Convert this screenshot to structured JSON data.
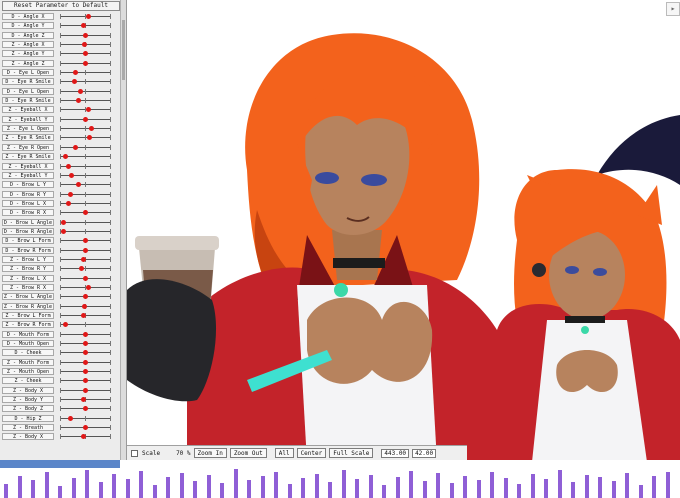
{
  "panel": {
    "reset_label": "Reset Parameter to Default",
    "params": [
      {
        "label": "D - Angle X",
        "value": 0.55
      },
      {
        "label": "D - Angle Y",
        "value": 0.45
      },
      {
        "label": "D - Angle Z",
        "value": 0.5
      },
      {
        "label": "Z - Angle X",
        "value": 0.48
      },
      {
        "label": "Z - Angle Y",
        "value": 0.5
      },
      {
        "label": "Z - Angle Z",
        "value": 0.5
      },
      {
        "label": "D - Eye L Open",
        "value": 0.3
      },
      {
        "label": "D - Eye R Smile",
        "value": 0.28
      },
      {
        "label": "D - Eye L Open",
        "value": 0.4
      },
      {
        "label": "D - Eye R Smile",
        "value": 0.35
      },
      {
        "label": "Z - Eyeball X",
        "value": 0.55
      },
      {
        "label": "Z - Eyeball Y",
        "value": 0.5
      },
      {
        "label": "Z - Eye L Open",
        "value": 0.62
      },
      {
        "label": "Z - Eye R Smile",
        "value": 0.58
      },
      {
        "label": "Z - Eye R Open",
        "value": 0.3
      },
      {
        "label": "Z - Eye R Smile",
        "value": 0.1
      },
      {
        "label": "Z - Eyeball X",
        "value": 0.15
      },
      {
        "label": "Z - Eyeball Y",
        "value": 0.22
      },
      {
        "label": "D - Brow L Y",
        "value": 0.35
      },
      {
        "label": "D - Brow R Y",
        "value": 0.2
      },
      {
        "label": "D - Brow L X",
        "value": 0.15
      },
      {
        "label": "D - Brow R X",
        "value": 0.5
      },
      {
        "label": "D - Brow L Angle",
        "value": 0.05
      },
      {
        "label": "D - Brow R Angle",
        "value": 0.05
      },
      {
        "label": "D - Brow L Form",
        "value": 0.5
      },
      {
        "label": "D - Brow R Form",
        "value": 0.5
      },
      {
        "label": "Z - Brow L Y",
        "value": 0.45
      },
      {
        "label": "Z - Brow R Y",
        "value": 0.42
      },
      {
        "label": "Z - Brow L X",
        "value": 0.5
      },
      {
        "label": "Z - Brow R X",
        "value": 0.55
      },
      {
        "label": "Z - Brow L Angle",
        "value": 0.5
      },
      {
        "label": "Z - Brow R Angle",
        "value": 0.48
      },
      {
        "label": "Z - Brow L Form",
        "value": 0.45
      },
      {
        "label": "Z - Brow R Form",
        "value": 0.1
      },
      {
        "label": "D - Mouth Form",
        "value": 0.5
      },
      {
        "label": "D - Mouth Open",
        "value": 0.5
      },
      {
        "label": "D - Cheek",
        "value": 0.5
      },
      {
        "label": "Z - Mouth Form",
        "value": 0.5
      },
      {
        "label": "Z - Mouth Open",
        "value": 0.5
      },
      {
        "label": "Z - Cheek",
        "value": 0.5
      },
      {
        "label": "Z - Body X",
        "value": 0.5
      },
      {
        "label": "Z - Body Y",
        "value": 0.45
      },
      {
        "label": "Z - Body Z",
        "value": 0.5
      },
      {
        "label": "D - Hip Z",
        "value": 0.2
      },
      {
        "label": "Z - Breath",
        "value": 0.5
      },
      {
        "label": "Z - Body X",
        "value": 0.45
      }
    ]
  },
  "toolbar": {
    "scale_label": "Scale",
    "scale_value": "70 %",
    "zoom_in": "Zoom In",
    "zoom_out": "Zoom Out",
    "all": "All",
    "center": "Center",
    "full_scale": "Full Scale",
    "coord_x": "443.00",
    "coord_y": "42.00"
  },
  "colors": {
    "hair": "#f3621c",
    "hair_dark": "#c84410",
    "skin": "#b7835e",
    "skin_shadow": "#8c5a3c",
    "jacket": "#c3232a",
    "jacket_dark": "#7a1216",
    "shirt": "#f4f4f6",
    "cup": "#c7bdb3",
    "cup_sleeve": "#7a5a48",
    "glove": "#26262a",
    "gem": "#3bd8a8",
    "wave": "#8f5fd6",
    "wave_top": "#5b86c9",
    "knob": "#e01818"
  }
}
